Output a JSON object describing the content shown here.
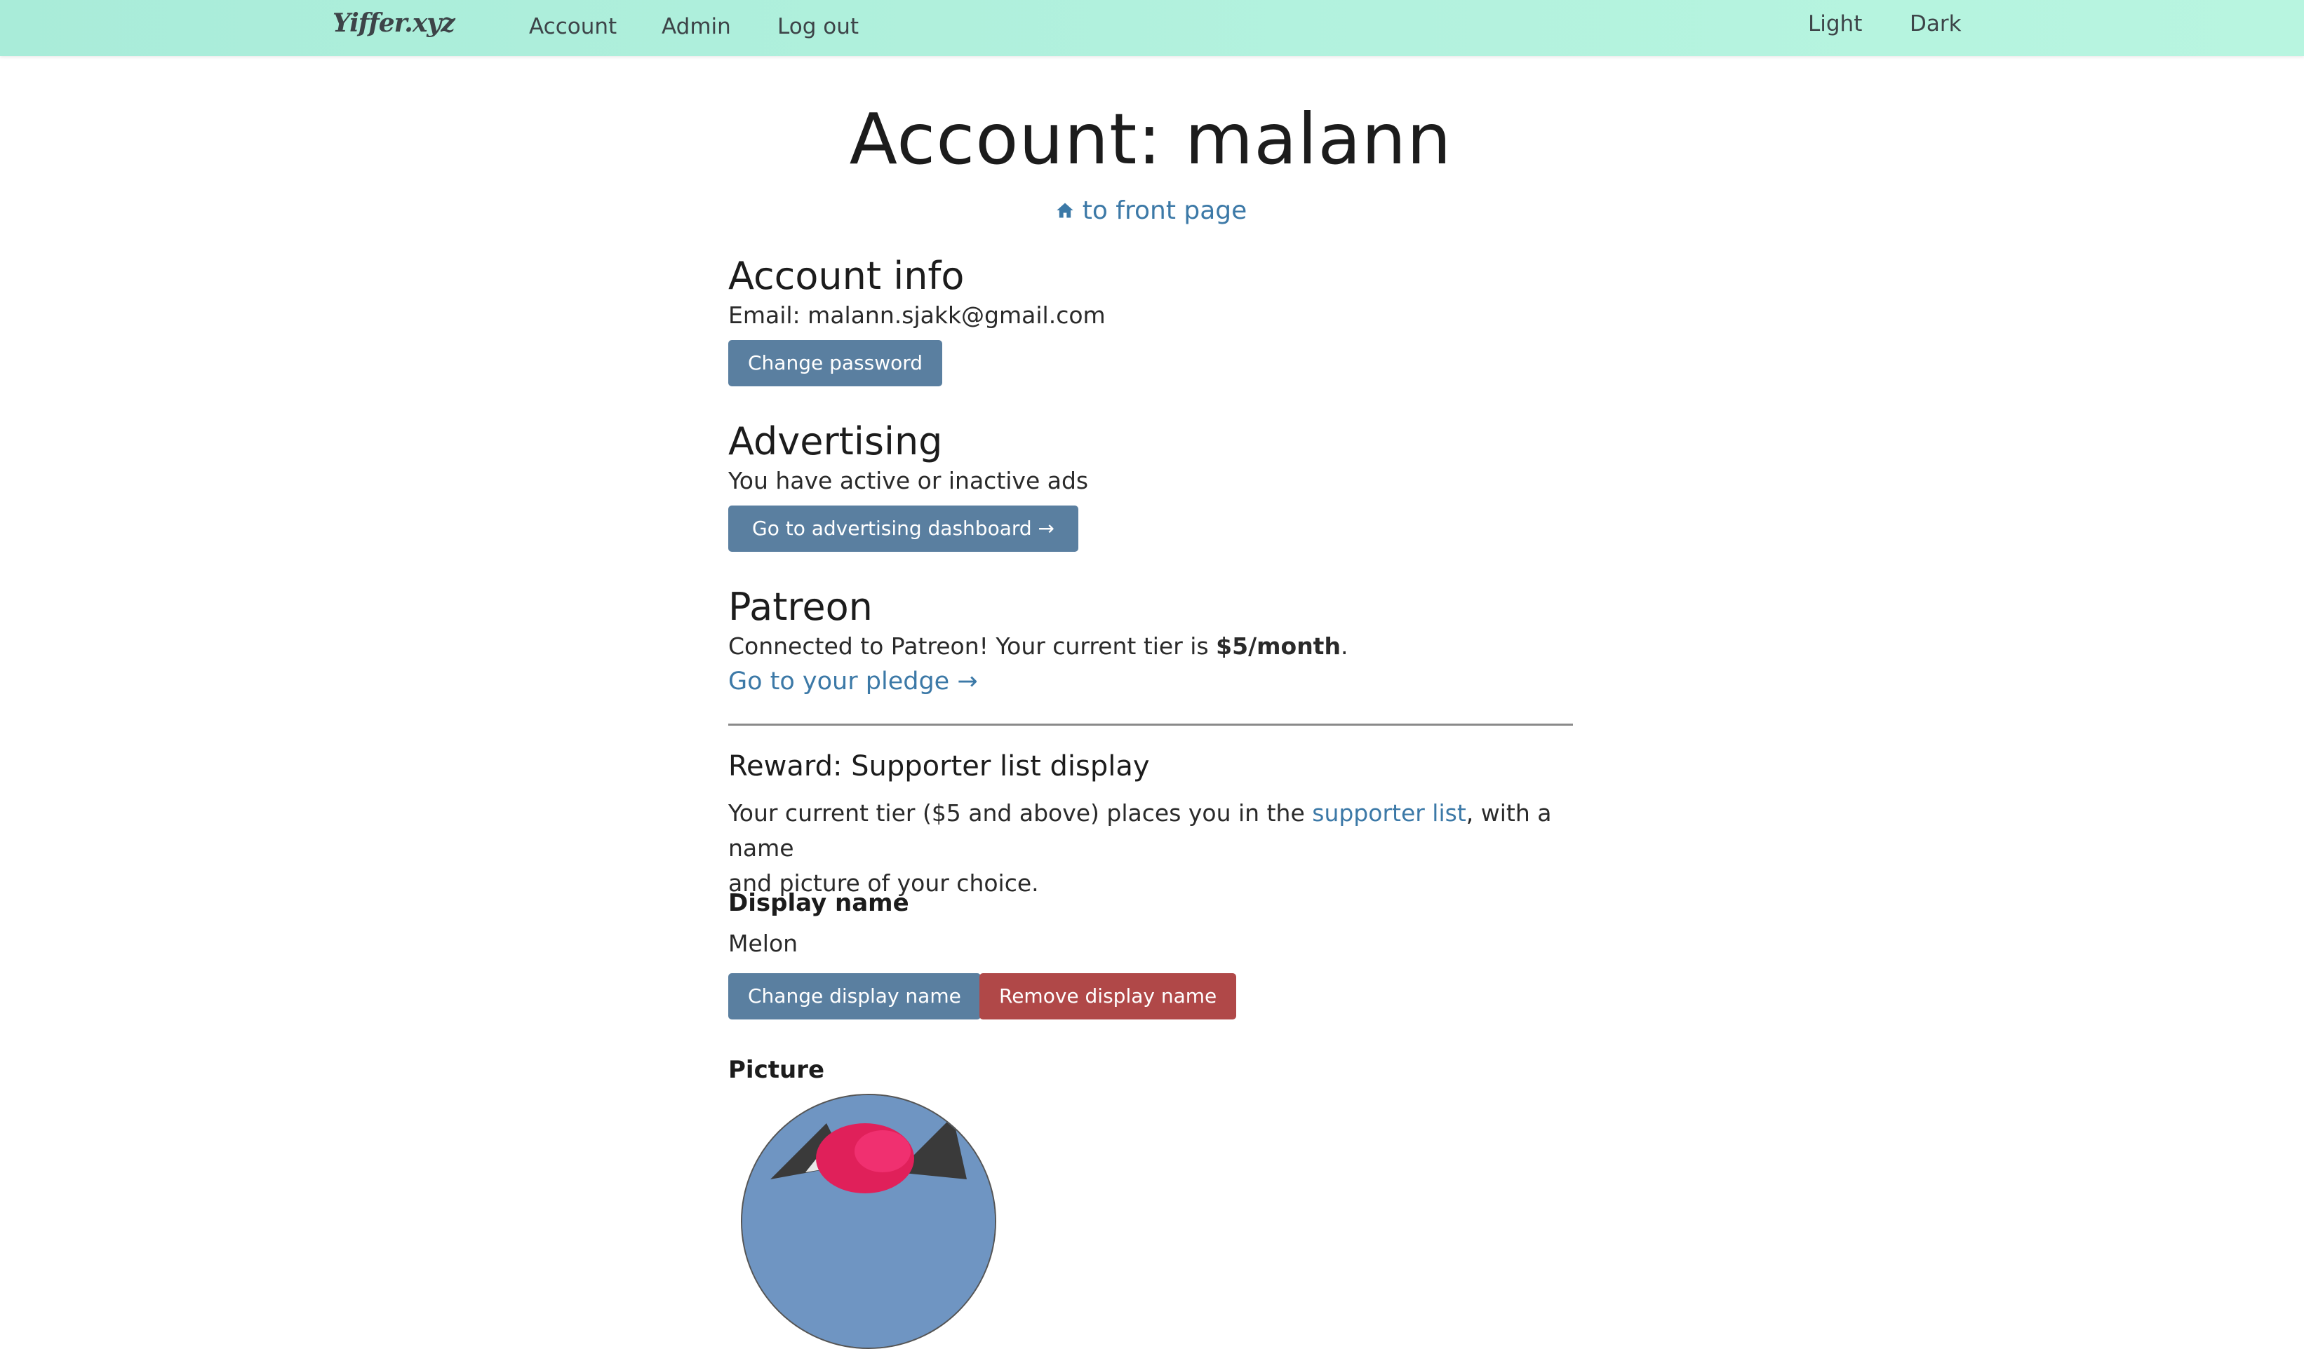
{
  "topbar": {
    "logo": "Yiffer.xyz",
    "nav": {
      "account": "Account",
      "admin": "Admin",
      "logout": "Log out"
    },
    "theme": {
      "light": "Light",
      "dark": "Dark"
    }
  },
  "page": {
    "title": "Account: malann",
    "front_link": "to front page"
  },
  "account_info": {
    "heading": "Account info",
    "email_label": "Email: ",
    "email": "malann.sjakk@gmail.com",
    "change_password": "Change password"
  },
  "advertising": {
    "heading": "Advertising",
    "text": "You have active or inactive ads",
    "button": "Go to advertising dashboard →"
  },
  "patreon": {
    "heading": "Patreon",
    "connected_text": "Connected to Patreon! Your current tier is ",
    "tier": "$5/month",
    "period": ".",
    "pledge_link": "Go to your pledge →"
  },
  "reward": {
    "heading": "Reward: Supporter list display",
    "text_before": "Your current tier ($5 and above) places you in the ",
    "supporter_link": "supporter list",
    "text_after_line1": ", with a name",
    "text_line2": "and picture of your choice.",
    "display_name_heading": "Display name",
    "display_name_value": "Melon",
    "change_display_name": "Change display name",
    "remove_display_name": "Remove display name",
    "picture_heading": "Picture"
  },
  "colors": {
    "topbar_gradient": [
      "#a9ecd9",
      "#b8f5e0"
    ],
    "link": "#3c79a7",
    "button_primary": "#5a7fa0",
    "button_danger": "#b04848"
  }
}
